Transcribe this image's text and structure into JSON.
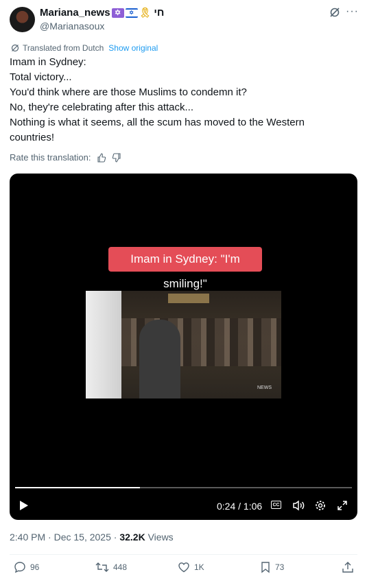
{
  "author": {
    "name": "Mariana_news",
    "name_suffix": "חי",
    "handle": "@Marianasoux"
  },
  "translation": {
    "note": "Translated from Dutch",
    "show_original": "Show original",
    "rate_label": "Rate this translation:"
  },
  "post": {
    "lines": [
      "Imam in Sydney:",
      "Total victory...",
      "You'd think where are those Muslims to condemn it?",
      "No, they're celebrating after this attack...",
      "Nothing is what it seems, all the scum has moved to the Western",
      "countries!"
    ]
  },
  "video": {
    "caption": "Imam in Sydney: \"I'm smiling!\"",
    "watermark": "NEWS",
    "time": "0:24 / 1:06",
    "cc_label": "CC",
    "progress_fraction": 0.37
  },
  "meta": {
    "time": "2:40 PM",
    "date": "Dec 15, 2025",
    "views_count": "32.2K",
    "views_label": "Views"
  },
  "actions": {
    "replies": "96",
    "reposts": "448",
    "likes": "1K",
    "bookmarks": "73"
  },
  "colors": {
    "link": "#1d9bf0",
    "muted": "#536471",
    "caption_bg": "#e44d57"
  }
}
